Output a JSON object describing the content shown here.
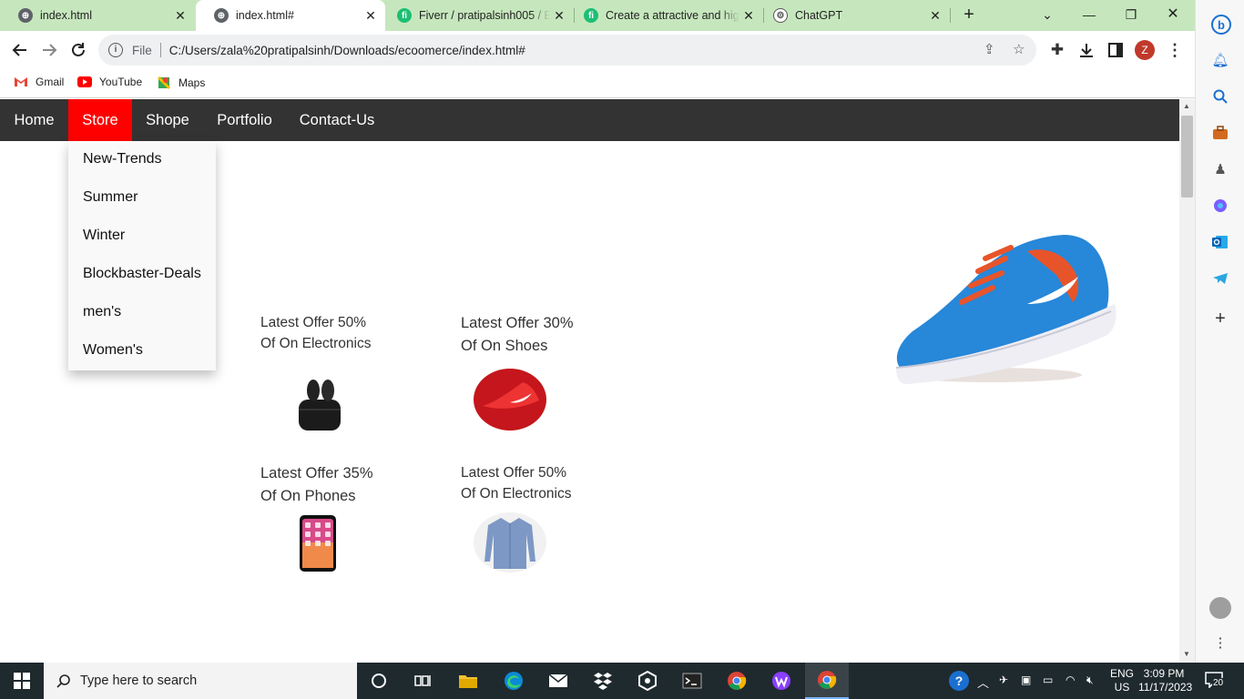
{
  "browser": {
    "tabs": [
      {
        "title": "index.html",
        "icon": "globe-icon",
        "active": false
      },
      {
        "title": "index.html#",
        "icon": "globe-icon",
        "active": true
      },
      {
        "title": "Fiverr / pratipalsinh005 / E",
        "icon": "fiverr-icon",
        "active": false
      },
      {
        "title": "Create a attractive and hig",
        "icon": "fiverr-icon",
        "active": false
      },
      {
        "title": "ChatGPT",
        "icon": "chatgpt-icon",
        "active": false
      }
    ],
    "close_glyph": "✕",
    "new_tab_glyph": "+",
    "omnibox": {
      "scheme_label": "File",
      "url": "C:/Users/zala%20pratipalsinh/Downloads/ecoomerce/index.html#"
    },
    "profile_initial": "Z",
    "bookmarks": [
      {
        "label": "Gmail",
        "icon": "gmail-icon"
      },
      {
        "label": "YouTube",
        "icon": "youtube-icon"
      },
      {
        "label": "Maps",
        "icon": "maps-icon"
      }
    ]
  },
  "site": {
    "nav": [
      {
        "label": "Home",
        "active": false
      },
      {
        "label": "Store",
        "active": true
      },
      {
        "label": "Shope",
        "active": false
      },
      {
        "label": "Portfolio",
        "active": false
      },
      {
        "label": "Contact-Us",
        "active": false
      }
    ],
    "dropdown": [
      "New-Trends",
      "Summer",
      "Winter",
      "Blockbaster-Deals",
      "men's",
      "Women's"
    ],
    "offers": [
      {
        "line1": "Latest Offer 50%",
        "line2": "Of On Electronics",
        "image": "earbuds-image"
      },
      {
        "line1": "Latest Offer 30%",
        "line2": "Of On Shoes",
        "image": "red-shoe-image"
      },
      {
        "line1": "Latest Offer 35%",
        "line2": "Of On Phones",
        "image": "phone-image"
      },
      {
        "line1": "Latest Offer 50%",
        "line2": "Of On Electronics",
        "image": "shirt-image"
      }
    ],
    "hero_image": "blue-sneaker-image",
    "colors": {
      "navbar": "#333333",
      "active_nav": "#ff0000"
    }
  },
  "taskbar": {
    "search_placeholder": "Type here to search",
    "language": "ENG",
    "region": "US",
    "time": "3:09 PM",
    "date": "11/17/2023",
    "notifications": "20"
  }
}
